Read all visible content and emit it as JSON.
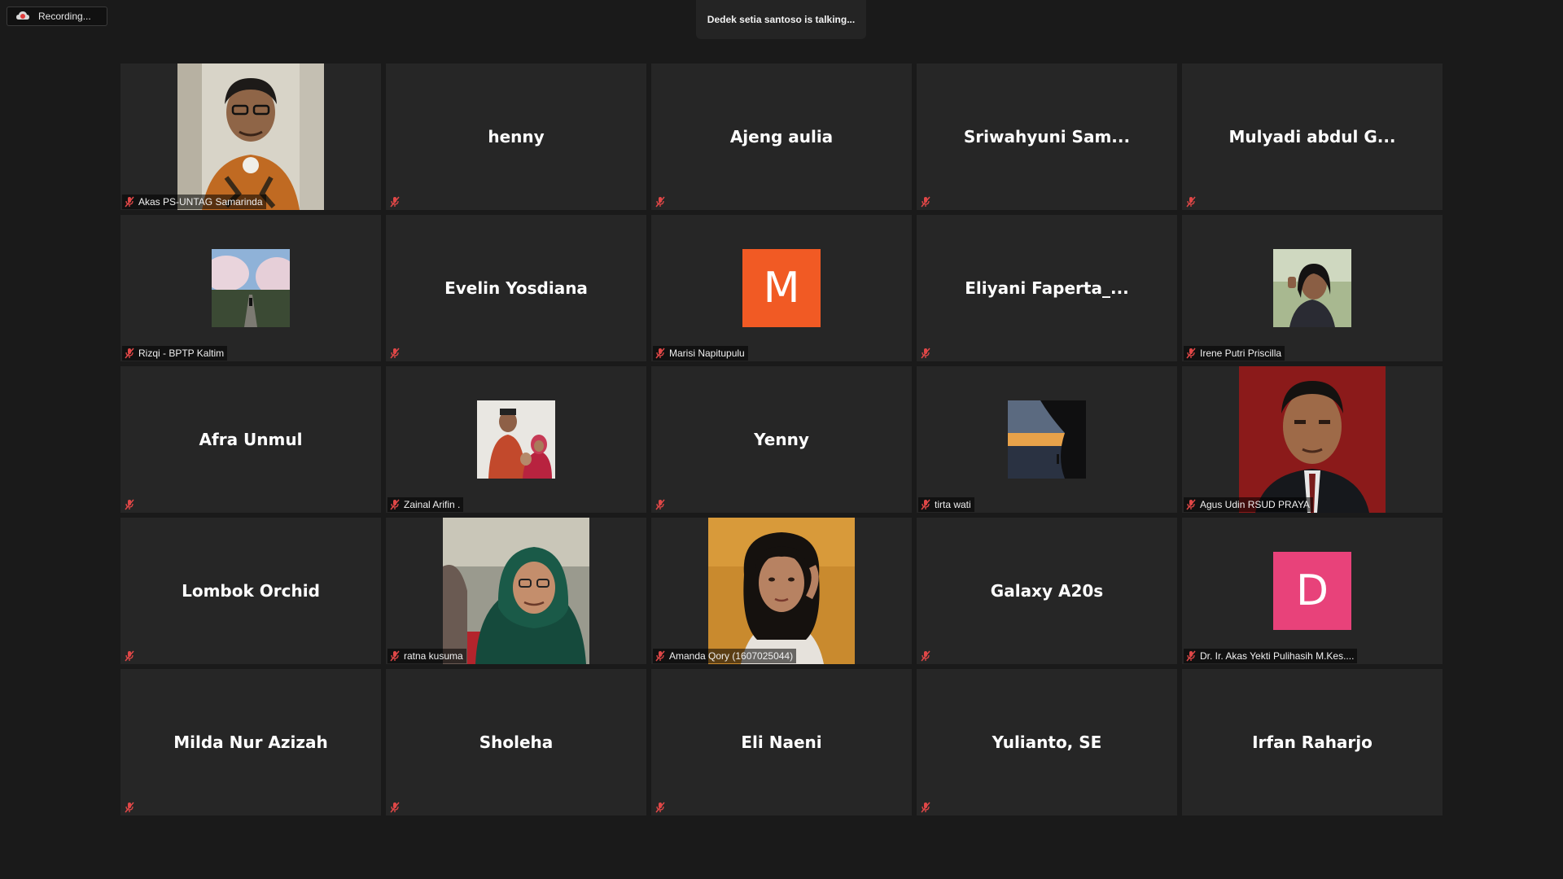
{
  "recording": {
    "label": "Recording...",
    "icon": "cloud-record-icon"
  },
  "active_speaker": {
    "text": "Dedek setia santoso is talking..."
  },
  "colors": {
    "background": "#1a1a1a",
    "tile": "#262626",
    "muted": "#e04747",
    "avatar_m": "#f15a24",
    "avatar_d": "#e8427a"
  },
  "tiles": [
    {
      "name": "Akas PS-UNTAG Samarinda",
      "type": "video"
    },
    {
      "name": "henny",
      "type": "name"
    },
    {
      "name": "Ajeng aulia",
      "type": "name"
    },
    {
      "name": "Sriwahyuni  Sam...",
      "type": "name"
    },
    {
      "name": "Mulyadi abdul G...",
      "type": "name"
    },
    {
      "name": "Rizqi - BPTP Kaltim",
      "type": "thumb"
    },
    {
      "name": "Evelin Yosdiana",
      "type": "name"
    },
    {
      "name": "Marisi Napitupulu",
      "type": "letter",
      "letter": "M"
    },
    {
      "name": "Eliyani  Faperta_...",
      "type": "name"
    },
    {
      "name": "Irene Putri Priscilla",
      "type": "thumb"
    },
    {
      "name": "Afra Unmul",
      "type": "name"
    },
    {
      "name": "Zainal Arifin .",
      "type": "thumb"
    },
    {
      "name": "Yenny",
      "type": "name"
    },
    {
      "name": "tirta wati",
      "type": "thumb"
    },
    {
      "name": "Agus Udin RSUD PRAYA",
      "type": "video"
    },
    {
      "name": "Lombok Orchid",
      "type": "name"
    },
    {
      "name": "ratna kusuma",
      "type": "video"
    },
    {
      "name": "Amanda Qory (1607025044)",
      "type": "video"
    },
    {
      "name": "Galaxy A20s",
      "type": "name"
    },
    {
      "name": "Dr. Ir. Akas Yekti Pulihasih M.Kes....",
      "type": "letter",
      "letter": "D"
    },
    {
      "name": "Milda Nur Azizah",
      "type": "name"
    },
    {
      "name": "Sholeha",
      "type": "name"
    },
    {
      "name": "Eli Naeni",
      "type": "name"
    },
    {
      "name": "Yulianto, SE",
      "type": "name"
    },
    {
      "name": "Irfan Raharjo",
      "type": "name"
    }
  ]
}
